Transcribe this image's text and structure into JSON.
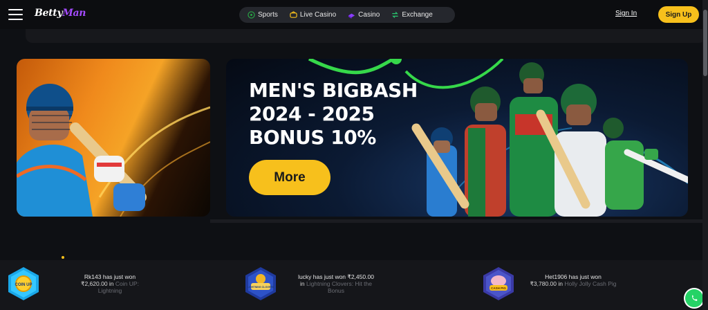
{
  "header": {
    "logo_text_part1": "Betty",
    "logo_text_part2": "Man",
    "nav": [
      {
        "label": "Sports",
        "icon": "soccer-ball-icon"
      },
      {
        "label": "Live Casino",
        "icon": "chip-icon"
      },
      {
        "label": "Casino",
        "icon": "dice-icon"
      },
      {
        "label": "Exchange",
        "icon": "exchange-arrows-icon"
      }
    ],
    "sign_in": "Sign In",
    "sign_up": "Sign Up"
  },
  "banner": {
    "title_line1": "MEN'S BIGBASH",
    "title_line2": "2024 - 2025",
    "title_line3": "BONUS 10%",
    "button": "More"
  },
  "wins": [
    {
      "user_line": "Rk143 has just won",
      "amount": "₹2,620.00",
      "in": "in",
      "game": "Coin UP: Lightning",
      "icon_label": "COIN UP"
    },
    {
      "user_line": "lucky has just won",
      "amount": "₹2,450.00",
      "in": "in",
      "game": "Lightning Clovers: Hit the Bonus",
      "icon_label": "LIGHTNING CLOVERS"
    },
    {
      "user_line": "Het1906 has just won",
      "amount": "₹3,780.00",
      "in": "in",
      "game": "Holly Jolly Cash Pig",
      "icon_label": "CASH PIG"
    }
  ],
  "colors": {
    "accent": "#f7c01c",
    "logo_purple": "#a44bff",
    "background": "#0e1014"
  }
}
